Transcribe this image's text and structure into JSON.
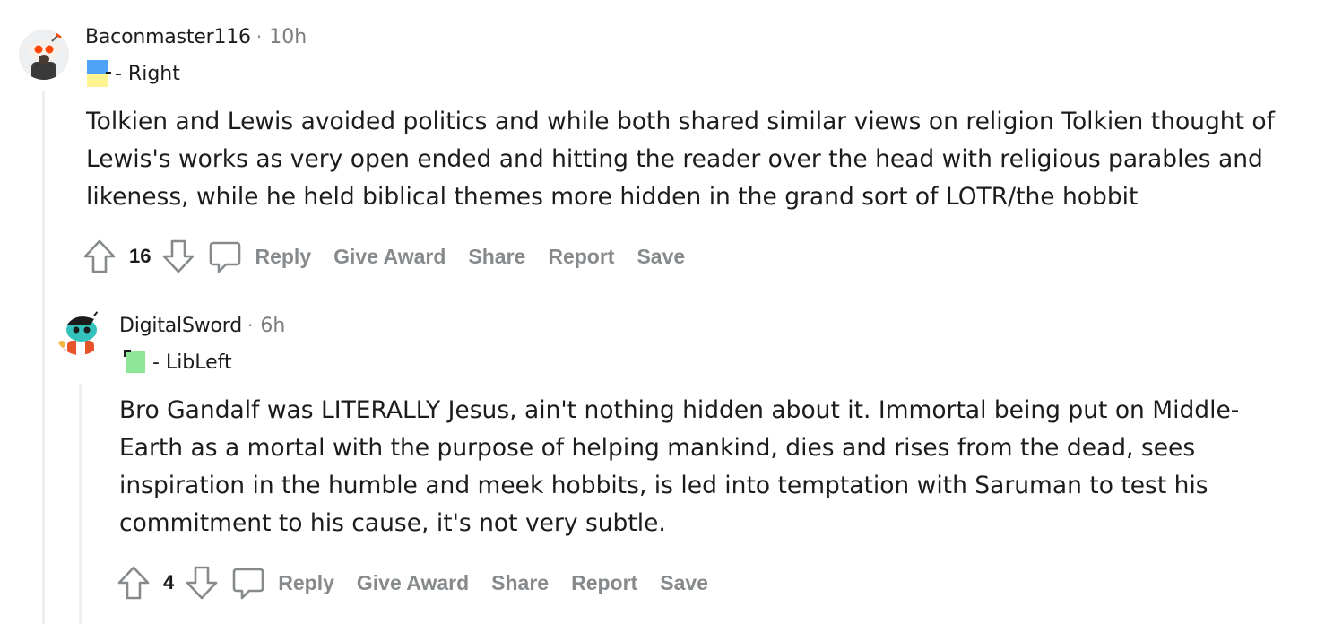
{
  "comments": [
    {
      "username": "Baconmaster116",
      "separator": "·",
      "time": "10h",
      "flair": "- Right",
      "flair_colors": {
        "top": "#4fa3f7",
        "bottom": "#fff48f"
      },
      "body": "Tolkien and Lewis avoided politics and while both shared similar views on religion Tolkien thought of Lewis's works as very open ended and hitting the reader over the head with religious parables and likeness, while he held biblical themes more hidden in the grand sort of LOTR/the hobbit",
      "score": "16",
      "actions": {
        "reply": "Reply",
        "award": "Give Award",
        "share": "Share",
        "report": "Report",
        "save": "Save"
      },
      "icons": {
        "upvote": "upvote-arrow-icon",
        "downvote": "downvote-arrow-icon",
        "comment": "comment-bubble-icon"
      }
    },
    {
      "username": "DigitalSword",
      "separator": "·",
      "time": "6h",
      "flair": "- LibLeft",
      "flair_colors": {
        "fill": "#8ee796"
      },
      "body": "Bro Gandalf was LITERALLY Jesus, ain't nothing hidden about it. Immortal being put on Middle-Earth as a mortal with the purpose of helping mankind, dies and rises from the dead, sees inspiration in the humble and meek hobbits, is led into temptation with Saruman to test his commitment to his cause, it's not very subtle.",
      "score": "4",
      "actions": {
        "reply": "Reply",
        "award": "Give Award",
        "share": "Share",
        "report": "Report",
        "save": "Save"
      },
      "icons": {
        "upvote": "upvote-arrow-icon",
        "downvote": "downvote-arrow-icon",
        "comment": "comment-bubble-icon"
      }
    }
  ],
  "colors": {
    "action_gray": "#878a8c",
    "thread_line": "#edeff1",
    "text": "#1c1c1c"
  }
}
